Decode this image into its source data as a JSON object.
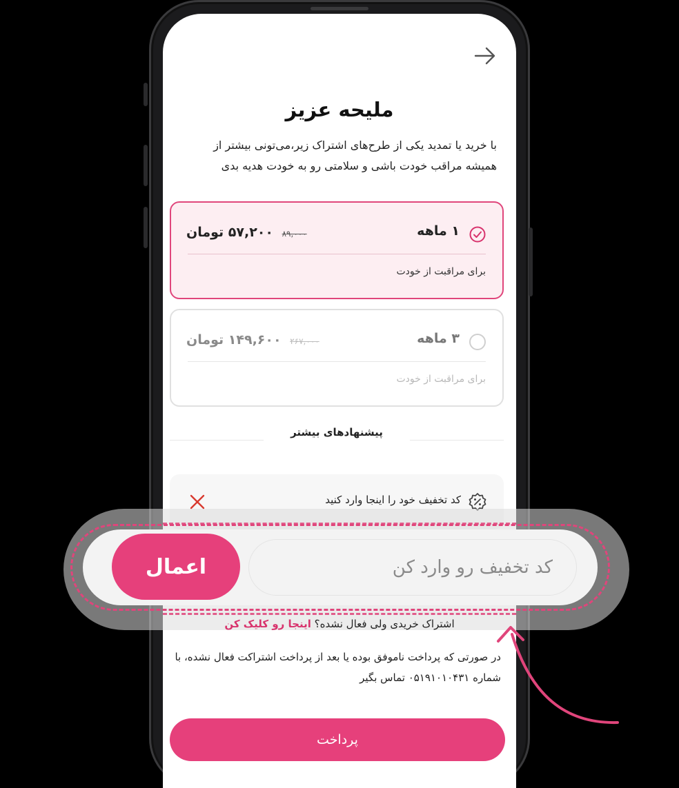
{
  "header": {
    "back_icon": "arrow-right-icon"
  },
  "title": "ملیحه عزیز",
  "subtitle": "با خرید یا تمدید یکی از طرح‌های اشتراک زیر،می‌تونی بیشتر از همیشه مراقب خودت باشی و سلامتی رو به خودت هدیه بدی",
  "plans": [
    {
      "name": "۱ ماهه",
      "old_price": "۸۹,۰۰۰",
      "price": "۵۷,۲۰۰ تومان",
      "desc": "برای مراقبت از خودت",
      "selected": true
    },
    {
      "name": "۳ ماهه",
      "old_price": "۲۶۷,۰۰۰",
      "price": "۱۴۹,۶۰۰ تومان",
      "desc": "برای مراقبت از خودت",
      "selected": false
    }
  ],
  "more_offers": "پیشنهادهای بیشتر",
  "discount": {
    "label": "کد تخفیف خود را اینجا وارد کنید",
    "icon": "percent-badge-icon",
    "close_icon": "close-icon"
  },
  "callout": {
    "placeholder": "کد تخفیف رو وارد کن",
    "apply_label": "اعمال"
  },
  "issue": {
    "text": "اشتراک خریدی ولی فعال نشده؟",
    "link": "اینجا رو کلیک کن"
  },
  "help": "در صورتی که پرداخت ناموفق بوده یا بعد از پرداخت اشتراکت فعال نشده، با شماره ۰۵۱۹۱۰۱۰۴۳۱ تماس بگیر",
  "pay_label": "پرداخت",
  "colors": {
    "accent": "#e6407b",
    "selected_bg": "#fdeef2",
    "close": "#d83a2f"
  }
}
